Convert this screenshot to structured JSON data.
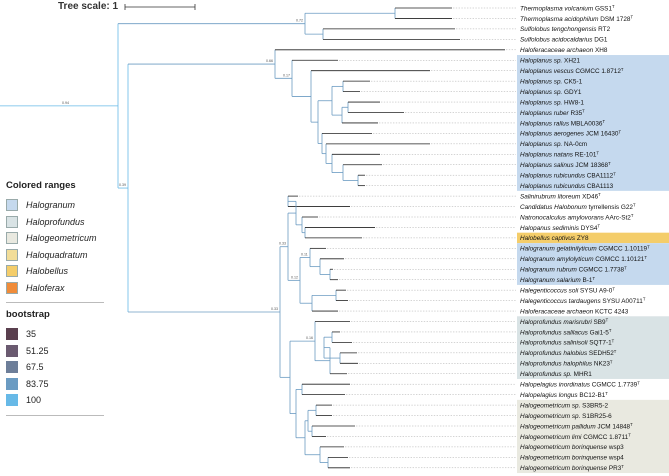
{
  "scale": {
    "label": "Tree scale: 1"
  },
  "legend": {
    "colored_ranges_title": "Colored ranges",
    "ranges": [
      {
        "name": "Halogranum",
        "color": "#c5d9ee"
      },
      {
        "name": "Haloprofundus",
        "color": "#d9e3e5"
      },
      {
        "name": "Halogeometricum",
        "color": "#e9e9e0"
      },
      {
        "name": "Haloquadratum",
        "color": "#f2dd98"
      },
      {
        "name": "Halobellus",
        "color": "#f4cd6a"
      },
      {
        "name": "Haloferax",
        "color": "#f08c3a"
      }
    ],
    "bootstrap_title": "bootstrap",
    "bootstrap": [
      {
        "value": "35",
        "color": "#5a3f4e"
      },
      {
        "value": "51.25",
        "color": "#6a5a70"
      },
      {
        "value": "67.5",
        "color": "#6d7e99"
      },
      {
        "value": "83.75",
        "color": "#6b9bc2"
      },
      {
        "value": "100",
        "color": "#67b9e7"
      }
    ]
  },
  "root_bootstrap": "0.94",
  "leaves": [
    {
      "name": "Thermoplasma volcanium GSS1",
      "sup": "T"
    },
    {
      "name": "Thermoplasma acidophilum DSM 1728",
      "sup": "T"
    },
    {
      "name": "Sulfolobus tengchongensis RT2",
      "sup": ""
    },
    {
      "name": "Sulfolobus acidocaldarius DG1",
      "sup": ""
    },
    {
      "name": "Haloferacaceae archaeon XH8",
      "sup": ""
    },
    {
      "name": "Haloplanus sp. XH21",
      "sup": ""
    },
    {
      "name": "Haloplanus vescus CGMCC 1.8712",
      "sup": "T"
    },
    {
      "name": "Haloplanus sp. CK5-1",
      "sup": ""
    },
    {
      "name": "Haloplanus sp. GDY1",
      "sup": ""
    },
    {
      "name": "Haloplanus sp. HW8-1",
      "sup": ""
    },
    {
      "name": "Haloplanus ruber R35",
      "sup": "T"
    },
    {
      "name": "Haloplanus rallus MBLA0036",
      "sup": "T"
    },
    {
      "name": "Haloplanus aerogenes JCM 16430",
      "sup": "T"
    },
    {
      "name": "Haloplanus sp. NA-0cm",
      "sup": ""
    },
    {
      "name": "Haloplanus natans RE-101",
      "sup": "T"
    },
    {
      "name": "Haloplanus salinus JCM 18368",
      "sup": "T"
    },
    {
      "name": "Haloplanus rubicundus CBA1112",
      "sup": "T"
    },
    {
      "name": "Haloplanus rubicundus CBA1113",
      "sup": ""
    },
    {
      "name": "Salinirubrum litoreum XD46",
      "sup": "T"
    },
    {
      "name": "Candidatus Halobonum tyrrellensis G22",
      "sup": "T"
    },
    {
      "name": "Natronocalculus amylovorans AArc-St2",
      "sup": "T"
    },
    {
      "name": "Halopanus sediminis DYS4",
      "sup": "T"
    },
    {
      "name": "Halobellus captivus ZY8",
      "sup": ""
    },
    {
      "name": "Halogranum gelatinilyticum CGMCC 1.10119",
      "sup": "T"
    },
    {
      "name": "Halogranum amylolyticum CGMCC 1.10121",
      "sup": "T"
    },
    {
      "name": "Halogranum rubrum CGMCC 1.7738",
      "sup": "T"
    },
    {
      "name": "Halogranum salarium B-1",
      "sup": "T"
    },
    {
      "name": "Halegenticoccus soli SYSU A9-0",
      "sup": "T"
    },
    {
      "name": "Halegenticoccus tardaugens SYSU A00711",
      "sup": "T"
    },
    {
      "name": "Haloferacaceae archaeon KCTC 4243",
      "sup": ""
    },
    {
      "name": "Haloprofundus marisrubri SB9",
      "sup": "T"
    },
    {
      "name": "Haloprofundus salilacus Gai1-5",
      "sup": "T"
    },
    {
      "name": "Haloprofundus salinisoli SQT7-1",
      "sup": "T"
    },
    {
      "name": "Haloprofundus halobius SEDH52",
      "sup": "T"
    },
    {
      "name": "Haloprofundus halophilus NK23",
      "sup": "T"
    },
    {
      "name": "Haloprofundus sp. MHR1",
      "sup": ""
    },
    {
      "name": "Halopelagius inordinatus CGMCC 1.7739",
      "sup": "T"
    },
    {
      "name": "Halopelagius longus BC12-B1",
      "sup": "T"
    },
    {
      "name": "Halogeometricum sp. S3BR5-2",
      "sup": ""
    },
    {
      "name": "Halogeometricum sp. S1BR25-6",
      "sup": ""
    },
    {
      "name": "Halogeometricum pallidum JCM 14848",
      "sup": "T"
    },
    {
      "name": "Halogeometricum limi CGMCC 1.8711",
      "sup": "T"
    },
    {
      "name": "Halogeometricum borinquense wsp3",
      "sup": ""
    },
    {
      "name": "Halogeometricum borinquense wsp4",
      "sup": ""
    },
    {
      "name": "Halogeometricum borinquense PR3",
      "sup": "T"
    }
  ]
}
